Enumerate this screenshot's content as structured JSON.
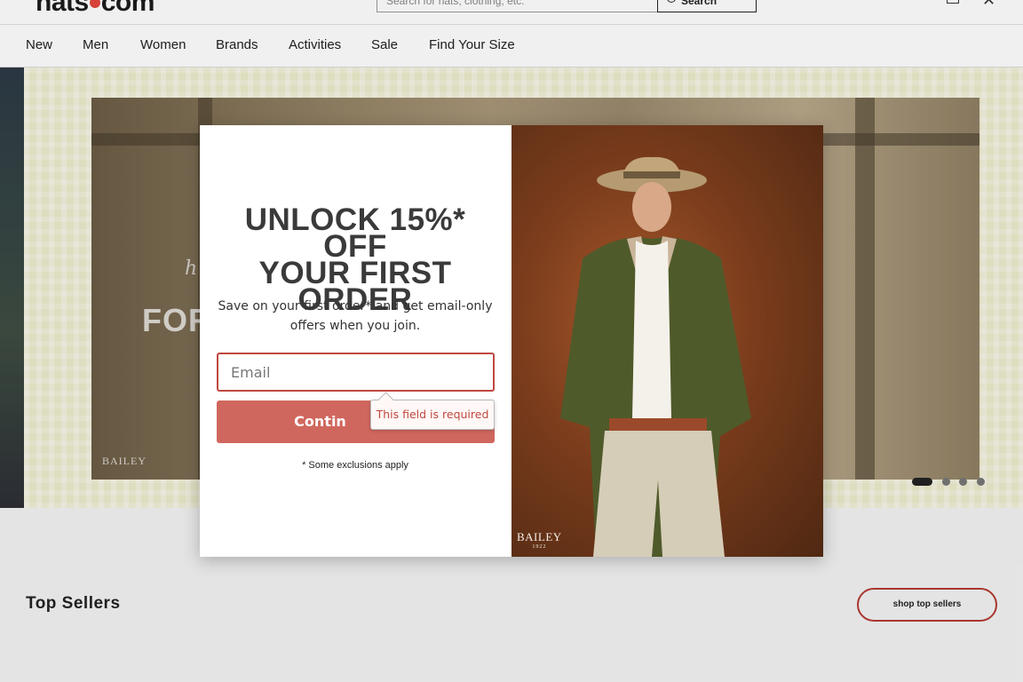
{
  "header": {
    "logo": {
      "left": "hats",
      "right": "com"
    },
    "search": {
      "placeholder": "Search for hats, clothing, etc.",
      "button_label": "Search"
    }
  },
  "nav": {
    "items": [
      "New",
      "Men",
      "Women",
      "Brands",
      "Activities",
      "Sale",
      "Find Your Size"
    ]
  },
  "hero": {
    "script_text": "h",
    "headline_text": "FOR A",
    "brand": "BAILEY",
    "carousel": {
      "active_index": 0,
      "slide_count": 4
    }
  },
  "top_sellers": {
    "title": "Top Sellers",
    "button_label": "shop top sellers"
  },
  "popup": {
    "headline_line1": "UNLOCK 15%* OFF",
    "headline_line2": "YOUR FIRST",
    "headline_line3": "ORDER",
    "subtext": "Save on your first order* and get email-only offers when you join.",
    "email_placeholder": "Email",
    "continue_label": "Contin",
    "validation_message": "This field is required",
    "exclusions": "* Some exclusions apply",
    "brand": "BAILEY",
    "brand_year": "1922"
  },
  "colors": {
    "accent": "#d0675e",
    "error": "#c0473f",
    "hero_bg": "#ecebcb"
  }
}
